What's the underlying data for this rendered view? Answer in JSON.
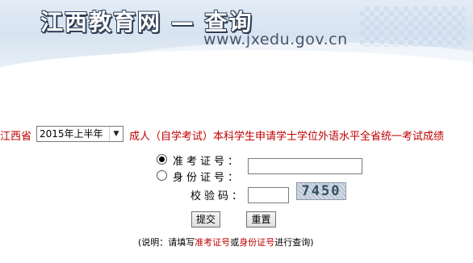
{
  "banner": {
    "logo_text": "江西教育网 — 查询",
    "url": "www.jxedu.gov.cn"
  },
  "query": {
    "province": "江西省",
    "period_selected": "2015年上半年",
    "exam_title": "成人（自学考试）本科学生申请学士学位外语水平全省统一考试成绩"
  },
  "form": {
    "radio_admission": {
      "label": "准考证号：",
      "checked": true
    },
    "radio_id": {
      "label": "身份证号：",
      "checked": false
    },
    "id_value": "",
    "captcha_label": "校验码：",
    "captcha_value": "",
    "captcha_image_text": "7450",
    "submit_label": "提交",
    "reset_label": "重置"
  },
  "note": {
    "prefix": "(说明：请填写",
    "admission": "准考证号",
    "or": "或",
    "id": "身份证号",
    "suffix": "进行查询)"
  },
  "colors": {
    "accent": "#c00000",
    "banner_bg": "#dce6f2"
  }
}
